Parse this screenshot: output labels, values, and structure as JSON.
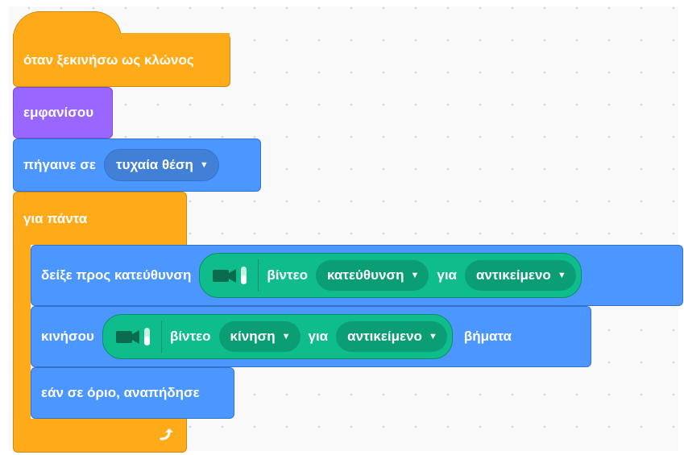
{
  "workspace": {
    "event_hat": {
      "label": "όταν ξεκινήσω ως κλώνος",
      "color": "#ffab19"
    },
    "show_block": {
      "label": "εμφανίσου",
      "color": "#9966ff"
    },
    "goto_block": {
      "label": "πήγαινε σε",
      "menu_value": "τυχαία θέση",
      "color": "#4c97ff"
    },
    "forever_block": {
      "label": "για πάντα",
      "color": "#ffab19",
      "loop_icon": "loop-arrow-icon"
    },
    "point_block": {
      "label": "δείξε προς κατεύθυνση",
      "reporter": {
        "icon": "video-camera-icon",
        "label": "βίντεο",
        "menu1_value": "κατεύθυνση",
        "connector": "για",
        "menu2_value": "αντικείμενο",
        "color": "#0fbd8c"
      }
    },
    "move_block": {
      "label": "κινήσου",
      "reporter": {
        "icon": "video-camera-icon",
        "label": "βίντεο",
        "menu1_value": "κίνηση",
        "connector": "για",
        "menu2_value": "αντικείμενο",
        "color": "#0fbd8c"
      },
      "suffix": "βήματα"
    },
    "bounce_block": {
      "label": "εάν σε όριο, αναπήδησε"
    }
  }
}
